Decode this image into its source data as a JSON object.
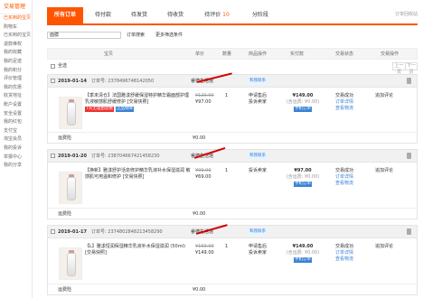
{
  "sidebar": {
    "title": "交易管理",
    "items": [
      {
        "label": "已买到的宝贝",
        "active": true
      },
      {
        "label": "购物车"
      },
      {
        "label": "已买到的宝贝"
      },
      {
        "label": "退款维权"
      },
      {
        "label": "我的收藏"
      },
      {
        "label": "我的足迹"
      },
      {
        "label": "我的积分"
      },
      {
        "label": "评价管理"
      },
      {
        "label": "我的优惠"
      },
      {
        "label": "收货地址"
      },
      {
        "label": "账户设置"
      },
      {
        "label": "安全设置"
      },
      {
        "label": "我的红包"
      },
      {
        "label": "支付宝"
      },
      {
        "label": "淘宝会员"
      },
      {
        "label": "我的投诉"
      },
      {
        "label": "举报中心"
      },
      {
        "label": "我的分享"
      }
    ]
  },
  "tabs": [
    {
      "label": "所有订单",
      "count": "",
      "active": true
    },
    {
      "label": "待付款",
      "count": ""
    },
    {
      "label": "待发货",
      "count": ""
    },
    {
      "label": "待收货",
      "count": ""
    },
    {
      "label": "待评价",
      "count": "10"
    },
    {
      "label": "分阶段",
      "count": ""
    }
  ],
  "recycle_label": "订单回收站",
  "search": {
    "value": "面膜",
    "button": "订单搜索",
    "advanced": "更多筛选条件"
  },
  "table_headers": [
    "宝贝",
    "单价",
    "数量",
    "商品操作",
    "实付款",
    "交易状态",
    "交易操作"
  ],
  "toolbar": {
    "select_all": "全选",
    "prev": "上一页",
    "next": "下一页"
  },
  "orders": [
    {
      "date": "2019-01-14",
      "order_no": "订单号: 2378496748142050",
      "shop": "睿德生活馆",
      "wangwang": "和我联系",
      "title": "【季末清仓】法国雅漾舒缓保湿特护精华霜面部护理乳液敏感肌舒缓修护 [交易快照]",
      "tag1": "7天无理由退换",
      "tag2": "正品保障",
      "orig_price": "¥129.00",
      "price": "¥97.00",
      "qty": "1",
      "actions": [
        "申请售后",
        "投诉卖家"
      ],
      "total": "¥149.00",
      "shipping": "(含运费: ¥0.00)",
      "pay_badge": "手机订单",
      "status": [
        "交易成功",
        "订单详情",
        "查看物流"
      ],
      "op": "追加评论",
      "sub_label": "运费险",
      "sub_amount": "¥0.00"
    },
    {
      "date": "2019-01-20",
      "order_no": "订单号: 238704667421458230",
      "shop": "睿德生活馆",
      "wangwang": "和我联系",
      "title": "【换新】雅漾舒护活泉修护精华乳液补水保湿滋润 敏感肌可用温和修护 [交易快照]",
      "tag1": "",
      "tag2": "",
      "orig_price": "¥99.00",
      "price": "¥69.00",
      "qty": "1",
      "actions": [
        "投诉卖家"
      ],
      "total": "¥97.00",
      "shipping": "(含运费: ¥0.00)",
      "pay_badge": "手机订单",
      "status": [
        "交易成功",
        "订单详情",
        "查看物流"
      ],
      "op": "追加评论",
      "sub_label": "运费险",
      "sub_amount": "¥0.00"
    },
    {
      "date": "2019-01-17",
      "order_no": "订单号: 2374802848213458290",
      "shop": "睿德生活馆",
      "wangwang": "和我联系",
      "title": "【L】雅漾恒润保湿精华乳液补水保湿滋润 (50ml) [交易快照]",
      "tag1": "",
      "tag2": "",
      "orig_price": "¥159.00",
      "price": "¥149.00",
      "qty": "1",
      "actions": [
        "申请售后",
        "投诉卖家"
      ],
      "total": "¥149.00",
      "shipping": "(含运费: ¥0.00)",
      "pay_badge": "手机订单",
      "status": [
        "交易成功",
        "订单详情",
        "查看物流"
      ],
      "op": "追加评论",
      "sub_label": "运费险",
      "sub_amount": "¥0.00"
    }
  ]
}
